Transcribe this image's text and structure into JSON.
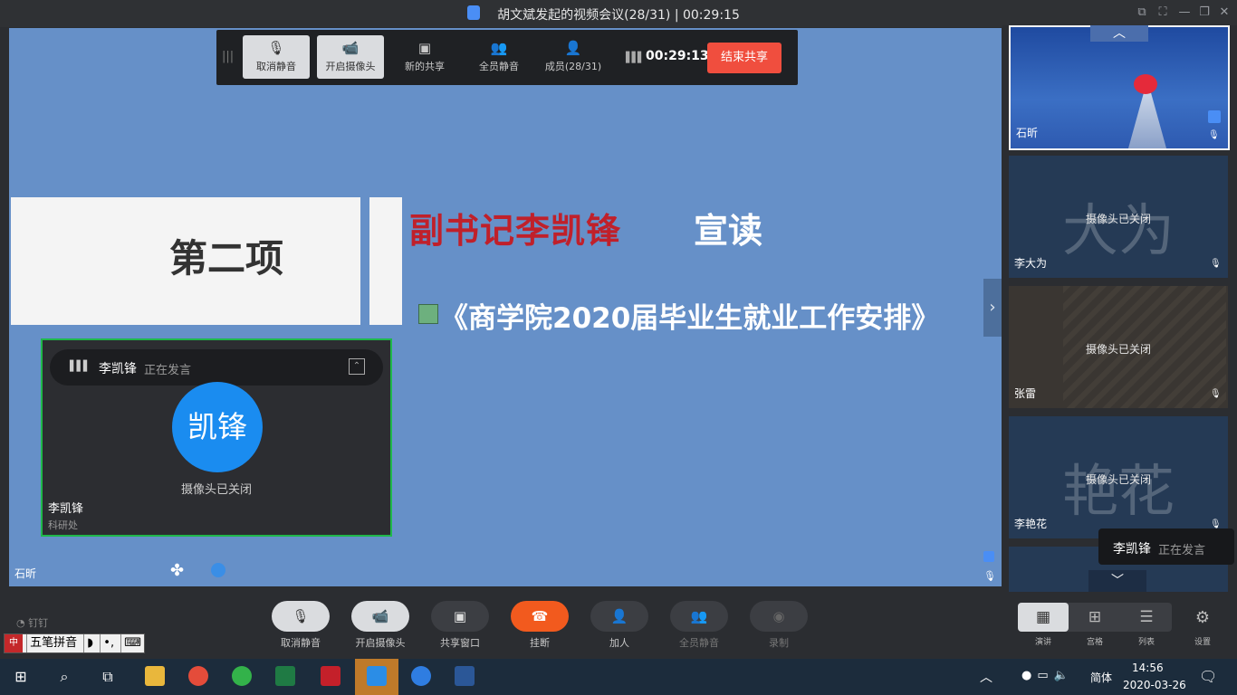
{
  "window": {
    "title": "胡文斌发起的视频会议(28/31) | 00:29:15"
  },
  "share_toolbar": {
    "buttons": [
      {
        "label": "取消静音",
        "icon": "mic-off-icon"
      },
      {
        "label": "开启摄像头",
        "icon": "camera-off-icon"
      },
      {
        "label": "新的共享",
        "icon": "share-screen-icon"
      },
      {
        "label": "全员静音",
        "icon": "mute-all-icon"
      },
      {
        "label": "成员(28/31)",
        "icon": "members-icon"
      }
    ],
    "timer": "00:29:13",
    "end_share_label": "结束共享"
  },
  "slide": {
    "item": "第二项",
    "speaker": "副书记李凯锋",
    "verb": "宣读",
    "document": "《商学院2020届毕业生就业工作安排》"
  },
  "active_speaker": {
    "name": "李凯锋",
    "status": "正在发言",
    "avatar_text": "凯锋",
    "camera_status": "摄像头已关闭",
    "dept": "科研处"
  },
  "share_owner": "石昕",
  "participants": [
    {
      "name": "石昕",
      "camera_status": "",
      "watermark": ""
    },
    {
      "name": "李大为",
      "camera_status": "摄像头已关闭",
      "watermark": "大为"
    },
    {
      "name": "张雷",
      "camera_status": "摄像头已关闭",
      "watermark": ""
    },
    {
      "name": "李艳花",
      "camera_status": "摄像头已关闭",
      "watermark": "艳花"
    }
  ],
  "speaking_toast": {
    "name": "李凯锋",
    "status": "正在发言"
  },
  "toolbar": {
    "buttons": [
      {
        "label": "取消静音",
        "icon": "mic-off-icon"
      },
      {
        "label": "开启摄像头",
        "icon": "camera-off-icon"
      },
      {
        "label": "共享窗口",
        "icon": "share-window-icon"
      },
      {
        "label": "挂断",
        "icon": "hangup-icon"
      },
      {
        "label": "加人",
        "icon": "add-person-icon"
      },
      {
        "label": "全员静音",
        "icon": "mute-all-icon"
      },
      {
        "label": "录制",
        "icon": "record-icon"
      }
    ],
    "layouts": [
      {
        "label": "演讲",
        "icon": "speaker-layout-icon"
      },
      {
        "label": "宫格",
        "icon": "grid-layout-icon"
      },
      {
        "label": "列表",
        "icon": "list-layout-icon"
      }
    ],
    "settings_label": "设置"
  },
  "brand": "钉钉",
  "ime": {
    "name": "五笔拼音"
  },
  "taskbar": {
    "time": "14:56",
    "date": "2020-03-26",
    "ime_lang": "简体"
  }
}
